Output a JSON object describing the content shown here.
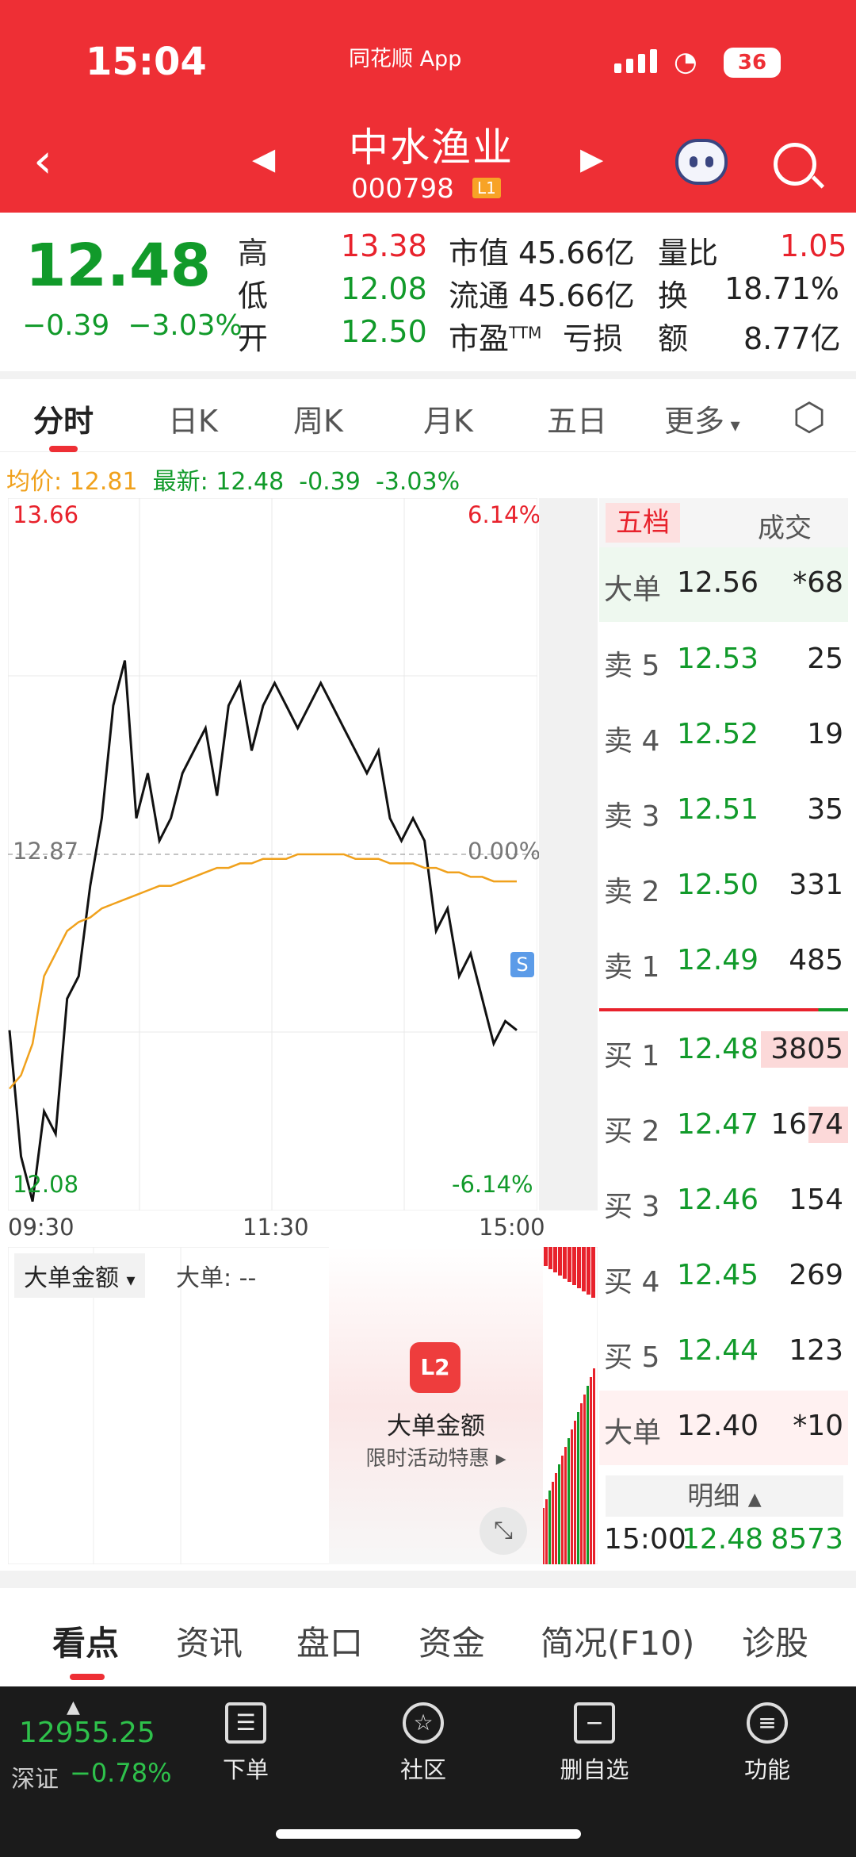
{
  "status": {
    "time": "15:04",
    "app": "同花顺 App",
    "battery": "36"
  },
  "header": {
    "name": "中水渔业",
    "code": "000798",
    "level": "L1"
  },
  "quote": {
    "price": "12.48",
    "change": "−0.39",
    "change_pct": "−3.03%",
    "high_k": "高",
    "high": "13.38",
    "low_k": "低",
    "low": "12.08",
    "open_k": "开",
    "open": "12.50",
    "mcap_k": "市值",
    "mcap": "45.66亿",
    "float_k": "流通",
    "float": "45.66亿",
    "pe_k": "市盈",
    "pe_sup": "TTM",
    "pe": "亏损",
    "vr_k": "量比",
    "vr": "1.05",
    "turn_k": "换",
    "turn": "18.71%",
    "amt_k": "额",
    "amt": "8.77亿"
  },
  "tabs": [
    "分时",
    "日K",
    "周K",
    "月K",
    "五日",
    "更多"
  ],
  "summary": {
    "avg_k": "均价:",
    "avg": "12.81",
    "latest_k": "最新:",
    "latest": "12.48",
    "chg": "-0.39",
    "pct": "-3.03%"
  },
  "chart_labels": {
    "top_left": "13.66",
    "top_right": "6.14%",
    "mid_left": "12.87",
    "mid_right": "0.00%",
    "bot_left": "12.08",
    "bot_right": "-6.14%",
    "s_marker": "S"
  },
  "time_axis": [
    "09:30",
    "11:30",
    "15:00"
  ],
  "book": {
    "tab_a": "五档",
    "tab_b": "成交",
    "big_sell": {
      "label": "大单",
      "price": "12.56",
      "vol": "*68"
    },
    "asks": [
      {
        "label": "卖 5",
        "price": "12.53",
        "vol": "25"
      },
      {
        "label": "卖 4",
        "price": "12.52",
        "vol": "19"
      },
      {
        "label": "卖 3",
        "price": "12.51",
        "vol": "35"
      },
      {
        "label": "卖 2",
        "price": "12.50",
        "vol": "331"
      },
      {
        "label": "卖 1",
        "price": "12.49",
        "vol": "485"
      }
    ],
    "bids": [
      {
        "label": "买 1",
        "price": "12.48",
        "vol": "3805"
      },
      {
        "label": "买 2",
        "price": "12.47",
        "vol": "1674"
      },
      {
        "label": "买 3",
        "price": "12.46",
        "vol": "154"
      },
      {
        "label": "买 4",
        "price": "12.45",
        "vol": "269"
      },
      {
        "label": "买 5",
        "price": "12.44",
        "vol": "123"
      }
    ],
    "big_buy": {
      "label": "大单",
      "price": "12.40",
      "vol": "*10"
    },
    "detail": "明细",
    "trade": {
      "time": "15:00",
      "price": "12.48",
      "vol": "8573"
    }
  },
  "lower": {
    "select": "大单金额",
    "big_k": "大单: --",
    "promo_title": "大单金额",
    "promo_sub": "限时活动特惠",
    "promo_logo": "L2"
  },
  "subtabs": [
    "看点",
    "资讯",
    "盘口",
    "资金",
    "简况(F10)",
    "诊股"
  ],
  "dock": {
    "index": "12955.25",
    "market": "深证",
    "pct": "−0.78%",
    "buttons": [
      {
        "label": "下单",
        "icon": "order-icon"
      },
      {
        "label": "社区",
        "icon": "community-icon"
      },
      {
        "label": "删自选",
        "icon": "remove-watchlist-icon"
      },
      {
        "label": "功能",
        "icon": "menu-icon"
      }
    ]
  },
  "chart_data": {
    "type": "line",
    "title": "",
    "ylim": [
      12.08,
      13.66
    ],
    "reference": 12.87,
    "series": [
      {
        "name": "最新",
        "values": [
          12.48,
          12.2,
          12.1,
          12.3,
          12.25,
          12.55,
          12.6,
          12.8,
          12.95,
          13.2,
          13.3,
          12.95,
          13.05,
          12.9,
          12.95,
          13.05,
          13.1,
          13.15,
          13.0,
          13.2,
          13.25,
          13.1,
          13.2,
          13.25,
          13.2,
          13.15,
          13.2,
          13.25,
          13.2,
          13.15,
          13.1,
          13.05,
          13.1,
          12.95,
          12.9,
          12.95,
          12.9,
          12.7,
          12.75,
          12.6,
          12.65,
          12.55,
          12.45,
          12.5,
          12.48
        ]
      },
      {
        "name": "均价",
        "values": [
          12.35,
          12.38,
          12.45,
          12.6,
          12.65,
          12.7,
          12.72,
          12.73,
          12.75,
          12.76,
          12.77,
          12.78,
          12.79,
          12.8,
          12.8,
          12.81,
          12.82,
          12.83,
          12.84,
          12.84,
          12.85,
          12.85,
          12.86,
          12.86,
          12.86,
          12.87,
          12.87,
          12.87,
          12.87,
          12.87,
          12.86,
          12.86,
          12.86,
          12.85,
          12.85,
          12.85,
          12.84,
          12.84,
          12.83,
          12.83,
          12.82,
          12.82,
          12.81,
          12.81,
          12.81
        ]
      }
    ]
  }
}
